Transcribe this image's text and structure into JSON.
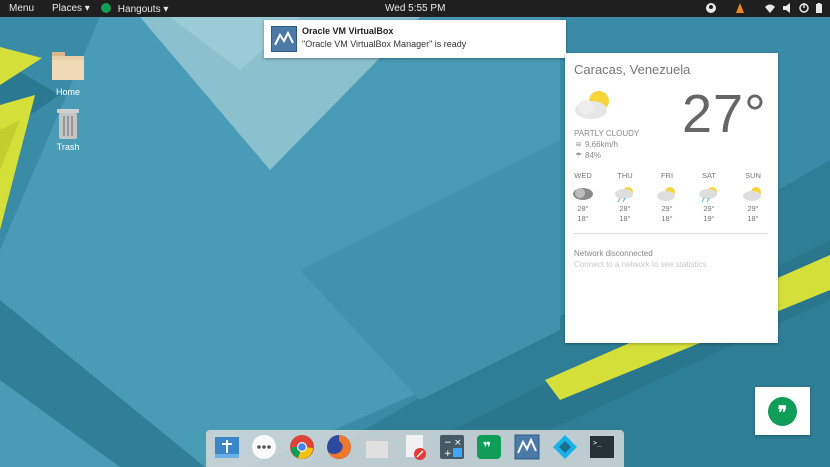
{
  "top_panel": {
    "menu_label": "Menu",
    "places_label": "Places",
    "places_arrow": "▾",
    "app_label": "Hangouts",
    "app_arrow": "▾",
    "clock": "Wed  5:55 PM"
  },
  "desktop": {
    "icons": [
      {
        "label": "Home"
      },
      {
        "label": "Trash"
      }
    ]
  },
  "notification": {
    "title": "Oracle VM VirtualBox",
    "body": "\"Oracle VM VirtualBox Manager\" is ready"
  },
  "weather": {
    "city": "Caracas, Venezuela",
    "temperature": "27°",
    "condition": "PARTLY CLOUDY",
    "wind": "9.66km/h",
    "humidity": "84%",
    "forecast": [
      {
        "day": "WED",
        "high": "28°",
        "low": "18°",
        "icon": "rain-cloud-icon"
      },
      {
        "day": "THU",
        "high": "28°",
        "low": "18°",
        "icon": "rain-sun-icon"
      },
      {
        "day": "FRI",
        "high": "29°",
        "low": "18°",
        "icon": "partly-cloudy-icon"
      },
      {
        "day": "SAT",
        "high": "29°",
        "low": "19°",
        "icon": "rain-sun-icon"
      },
      {
        "day": "SUN",
        "high": "29°",
        "low": "18°",
        "icon": "partly-cloudy-icon"
      }
    ],
    "network_status": "Network disconnected",
    "network_hint": "Connect to a network to see statistics"
  },
  "hangouts_bubble": {
    "glyph": "❞"
  },
  "dock": {
    "apps": [
      "app-store-icon",
      "app-launcher-icon",
      "chrome-icon",
      "firefox-icon",
      "files-icon",
      "text-editor-icon",
      "calculator-icon",
      "hangouts-icon",
      "virtualbox-icon",
      "kodi-icon",
      "terminal-icon"
    ]
  },
  "colors": {
    "panel": "#1f1f1f",
    "accent_yellow": "#d6e03a",
    "hangouts_green": "#0f9d58"
  }
}
